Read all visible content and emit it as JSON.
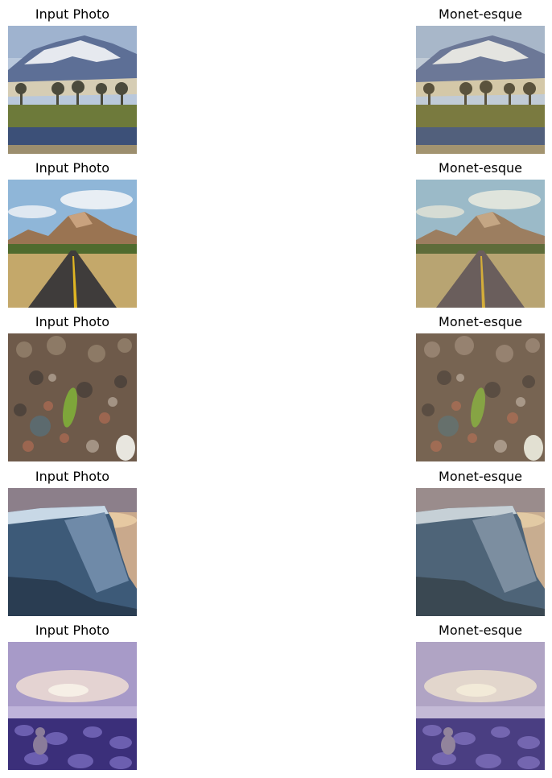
{
  "figure": {
    "rows": [
      {
        "input_title": "Input Photo",
        "output_title": "Monet-esque",
        "scene": "mountain-lake-icon"
      },
      {
        "input_title": "Input Photo",
        "output_title": "Monet-esque",
        "scene": "desert-road-icon"
      },
      {
        "input_title": "Input Photo",
        "output_title": "Monet-esque",
        "scene": "pebbles-leaf-icon"
      },
      {
        "input_title": "Input Photo",
        "output_title": "Monet-esque",
        "scene": "cliff-sunset-icon"
      },
      {
        "input_title": "Input Photo",
        "output_title": "Monet-esque",
        "scene": "rocky-beach-icon"
      }
    ]
  }
}
